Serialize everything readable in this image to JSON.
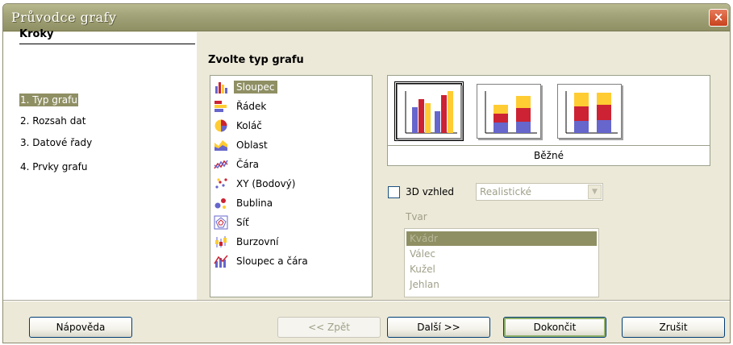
{
  "window": {
    "title": "Průvodce grafy",
    "close_icon": "×"
  },
  "steps": {
    "header": "Kroky",
    "items": [
      {
        "label": "1. Typ grafu",
        "active": true
      },
      {
        "label": "2. Rozsah dat",
        "active": false
      },
      {
        "label": "3. Datové řady",
        "active": false
      },
      {
        "label": "4. Prvky grafu",
        "active": false
      }
    ]
  },
  "chart_type": {
    "title": "Zvolte typ grafu",
    "types": [
      {
        "label": "Sloupec",
        "icon": "column-chart-icon",
        "selected": true
      },
      {
        "label": "Řádek",
        "icon": "bar-chart-icon",
        "selected": false
      },
      {
        "label": "Koláč",
        "icon": "pie-chart-icon",
        "selected": false
      },
      {
        "label": "Oblast",
        "icon": "area-chart-icon",
        "selected": false
      },
      {
        "label": "Čára",
        "icon": "line-chart-icon",
        "selected": false
      },
      {
        "label": "XY (Bodový)",
        "icon": "scatter-chart-icon",
        "selected": false
      },
      {
        "label": "Bublina",
        "icon": "bubble-chart-icon",
        "selected": false
      },
      {
        "label": "Síť",
        "icon": "net-chart-icon",
        "selected": false
      },
      {
        "label": "Burzovní",
        "icon": "stock-chart-icon",
        "selected": false
      },
      {
        "label": "Sloupec a čára",
        "icon": "column-line-chart-icon",
        "selected": false
      }
    ]
  },
  "variants": {
    "caption": "Běžné",
    "items": [
      {
        "name": "normal",
        "selected": true
      },
      {
        "name": "stacked",
        "selected": false
      },
      {
        "name": "percent-stacked",
        "selected": false
      }
    ]
  },
  "options": {
    "three_d_label": "3D vzhled",
    "three_d_checked": false,
    "appearance_value": "Realistické",
    "shape_label": "Tvar",
    "shapes": [
      {
        "label": "Kvádr",
        "selected": true
      },
      {
        "label": "Válec",
        "selected": false
      },
      {
        "label": "Kužel",
        "selected": false
      },
      {
        "label": "Jehlan",
        "selected": false
      }
    ]
  },
  "buttons": {
    "help": "Nápověda",
    "back": "<< Zpět",
    "next": "Další >>",
    "finish": "Dokončit",
    "cancel": "Zrušit"
  },
  "colors": {
    "selection": "#8F8F64",
    "bar_blue": "#6666CC",
    "bar_red": "#CC2233",
    "bar_yellow": "#FFCC33"
  }
}
